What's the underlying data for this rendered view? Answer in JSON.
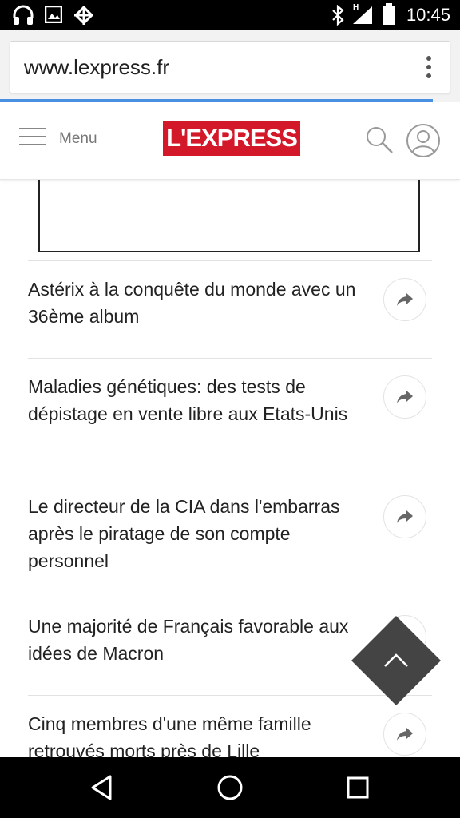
{
  "status_bar": {
    "time": "10:45",
    "network_label": "H",
    "left_icons": [
      "headphones-icon",
      "image-icon",
      "settings-icon"
    ],
    "right_icons": [
      "bluetooth-icon",
      "signal-icon",
      "battery-icon"
    ]
  },
  "browser": {
    "url": "www.lexpress.fr",
    "menu_icon": "kebab-menu-icon",
    "progress_color": "#4a90e2"
  },
  "site_header": {
    "menu_label": "Menu",
    "logo_text": "L'EXPRESS",
    "brand_color": "#d3182a",
    "search_icon": "search-icon",
    "user_icon": "user-icon"
  },
  "articles": [
    {
      "title": "Astérix à la conquête du monde avec un 36ème album"
    },
    {
      "title": "Maladies génétiques: des tests de dépistage en vente libre aux Etats-Unis"
    },
    {
      "title": "Le directeur de la CIA dans l'embarras après le piratage de son compte personnel"
    },
    {
      "title": "Une majorité de Français favorable aux idées de Macron"
    },
    {
      "title": "Cinq membres d'une même famille retrouvés morts près de Lille"
    }
  ],
  "scroll_top_icon": "chevron-up-icon",
  "nav_bar": {
    "icons": [
      "back-icon",
      "home-icon",
      "recents-icon"
    ]
  }
}
